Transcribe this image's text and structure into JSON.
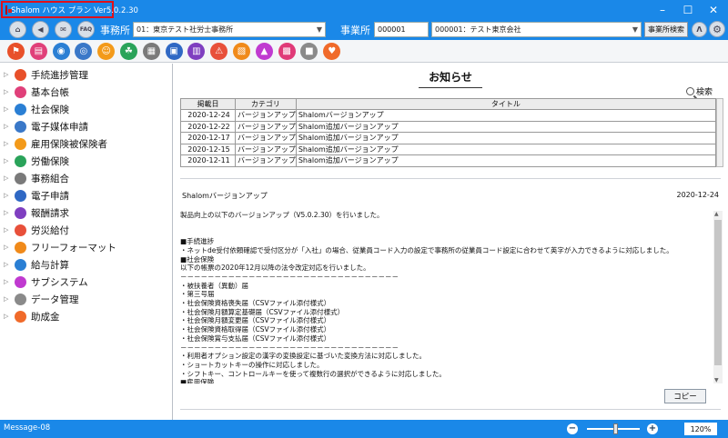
{
  "window": {
    "title": "Shalom ハウス プラン Ver5.0.2.30",
    "controls": [
      "minimize",
      "maximize",
      "close"
    ]
  },
  "toolbar": {
    "left_icons": [
      "home-icon",
      "back-icon",
      "mail-icon",
      "faq-icon"
    ],
    "faq_label": "FAQ",
    "office_label": "事務所",
    "office_value": "01：東京テスト社労士事務所",
    "company_label": "事業所",
    "company_code": "000001",
    "company_value": "000001：テスト東京会社",
    "company_search_label": "事業所検索",
    "right_icons": [
      "caret-up-icon",
      "gear-icon"
    ]
  },
  "quick_icons": [
    {
      "name": "progress-icon",
      "color": "#e8502a"
    },
    {
      "name": "ledger-icon",
      "color": "#e0407a"
    },
    {
      "name": "insurance-icon",
      "color": "#2a7fd4"
    },
    {
      "name": "media-icon",
      "color": "#3a78c8"
    },
    {
      "name": "employment-icon",
      "color": "#f39a1a"
    },
    {
      "name": "labor-icon",
      "color": "#2aa35a"
    },
    {
      "name": "union-icon",
      "color": "#7a7a7a"
    },
    {
      "name": "e-application-icon",
      "color": "#2f68c4"
    },
    {
      "name": "billing-icon",
      "color": "#7f3fc0"
    },
    {
      "name": "accident-icon",
      "color": "#e8503a"
    },
    {
      "name": "free-format-icon",
      "color": "#f08a1a"
    },
    {
      "name": "payroll-icon",
      "color": "#c03ad0"
    },
    {
      "name": "subsystem-icon",
      "color": "#e03a78"
    },
    {
      "name": "camera-icon",
      "color": "#8a8a8a"
    },
    {
      "name": "subsidy-icon",
      "color": "#f06a2a"
    }
  ],
  "sidebar": {
    "items": [
      {
        "label": "手続進捗管理",
        "color": "#e8502a"
      },
      {
        "label": "基本台帳",
        "color": "#e0407a"
      },
      {
        "label": "社会保険",
        "color": "#2a7fd4"
      },
      {
        "label": "電子媒体申請",
        "color": "#3a78c8"
      },
      {
        "label": "雇用保険被保険者",
        "color": "#f39a1a"
      },
      {
        "label": "労働保険",
        "color": "#2aa35a"
      },
      {
        "label": "事務組合",
        "color": "#7a7a7a"
      },
      {
        "label": "電子申請",
        "color": "#2f68c4"
      },
      {
        "label": "報酬請求",
        "color": "#7f3fc0"
      },
      {
        "label": "労災給付",
        "color": "#e8503a"
      },
      {
        "label": "フリーフォーマット",
        "color": "#f08a1a"
      },
      {
        "label": "給与計算",
        "color": "#2a7fd4"
      },
      {
        "label": "サブシステム",
        "color": "#c03ad0"
      },
      {
        "label": "データ管理",
        "color": "#8a8a8a"
      },
      {
        "label": "助成金",
        "color": "#f06a2a"
      }
    ]
  },
  "main": {
    "title": "お知らせ",
    "search_label": "検索",
    "table": {
      "headers": [
        "掲載日",
        "カテゴリ",
        "タイトル"
      ],
      "rows": [
        [
          "2020-12-24",
          "バージョンアップ",
          "Shalomバージョンアップ"
        ],
        [
          "2020-12-22",
          "バージョンアップ",
          "Shalom追加バージョンアップ"
        ],
        [
          "2020-12-17",
          "バージョンアップ",
          "Shalom追加バージョンアップ"
        ],
        [
          "2020-12-15",
          "バージョンアップ",
          "Shalom追加バージョンアップ"
        ],
        [
          "2020-12-11",
          "バージョンアップ",
          "Shalom追加バージョンアップ"
        ]
      ]
    },
    "detail": {
      "title": "Shalomバージョンアップ",
      "date": "2020-12-24",
      "body": "製品向上の以下のバージョンアップ（V5.0.2.30）を行いました。\n\n\n■手続進捗\n・ネットde受付依頼確認で受付区分が「入社」の場合、従業員コード入力の設定で事務所の従業員コード設定に合わせて英字が入力できるように対応しました。\n■社会保険\n以下の帳票の2020年12月以降の法令改定対応を行いました。\n－－－－－－－－－－－－－－－－－－－－－－－－－－－－－－－－\n・被扶養者（異動）届\n・第三号届\n・社会保険資格喪失届（CSVファイル添付様式）\n・社会保険月額算定基礎届（CSVファイル添付様式）\n・社会保険月額変更届（CSVファイル添付様式）\n・社会保険資格取得届（CSVファイル添付様式）\n・社会保険賞与支払届（CSVファイル添付様式）\n－－－－－－－－－－－－－－－－－－－－－－－－－－－－－－－－\n・利用者オプション設定の漢字の変換設定に基づいた変換方法に対応しました。\n・ショートカットキーの操作に対応しました。\n・シフトキー、コントロールキーを使って複数行の選択ができるように対応しました。\n■雇用保険"
    },
    "copy_label": "コピー"
  },
  "statusbar": {
    "message": "Message-08",
    "zoom": "120%",
    "zoom_level": 0.55
  }
}
